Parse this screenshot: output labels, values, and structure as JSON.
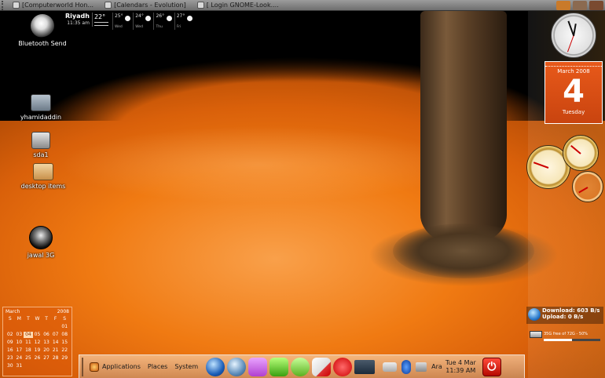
{
  "top_panel": {
    "tasks": [
      {
        "title": "[Computerworld Hon..."
      },
      {
        "title": "[Calendars - Evolution]"
      },
      {
        "title": "[ Login GNOME-Look...."
      }
    ]
  },
  "weather": {
    "city": "Riyadh",
    "time": "11:35 am",
    "current_temp": "22°",
    "forecast": [
      {
        "temp": "25°",
        "day": "Wed"
      },
      {
        "temp": "24°",
        "day": "Wed"
      },
      {
        "temp": "26°",
        "day": "Thu"
      },
      {
        "temp": "27°",
        "day": "Fri"
      }
    ]
  },
  "desktop_icons": [
    {
      "label": "Bluetooth Send"
    },
    {
      "label": "yhamidaddin"
    },
    {
      "label": "sda1"
    },
    {
      "label": "desktop items"
    },
    {
      "label": "jawal 3G"
    }
  ],
  "mini_calendar": {
    "month": "March",
    "year": "2008",
    "weekdays": [
      "S",
      "M",
      "T",
      "W",
      "T",
      "F",
      "S"
    ],
    "days": [
      "",
      "",
      "",
      "",
      "",
      "",
      "01",
      "02",
      "03",
      "04",
      "05",
      "06",
      "07",
      "08",
      "09",
      "10",
      "11",
      "12",
      "13",
      "14",
      "15",
      "16",
      "17",
      "18",
      "19",
      "20",
      "21",
      "22",
      "23",
      "24",
      "25",
      "26",
      "27",
      "28",
      "29",
      "30",
      "31",
      "",
      "",
      "",
      "",
      ""
    ],
    "today": "04"
  },
  "big_calendar": {
    "month_year": "March 2008",
    "day": "4",
    "weekday": "Tuesday"
  },
  "network": {
    "download": "Download: 603 B/s",
    "upload": "Upload: 0 B/s"
  },
  "disk": {
    "text": "35G free of 72G - 50%",
    "fill_fraction": 0.5
  },
  "bottom_panel": {
    "applications": "Applications",
    "places": "Places",
    "system": "System",
    "launcher_icons": [
      "firefox-icon",
      "globe-icon",
      "mail-icon",
      "browser-w-icon",
      "chat-icon",
      "text-editor-icon",
      "3g-icon",
      "terminal-icon"
    ],
    "tray_icons": [
      "notification-icon",
      "bluetooth-icon",
      "network-icon"
    ],
    "keyboard_layout": "Ara",
    "date": "Tue  4 Mar",
    "time": "11:39 AM"
  },
  "colors": {
    "pumpkin_orange": "#e8700f",
    "calendar_red": "#d9501a",
    "power_red": "#d61a0e"
  }
}
